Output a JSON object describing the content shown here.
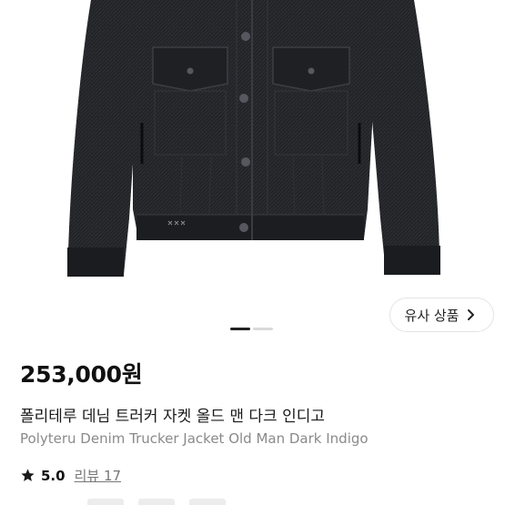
{
  "product": {
    "image_icon": "denim-jacket-photo",
    "price": "253,000원",
    "title_ko": "폴리테루 데님 트러커 자켓 올드 맨 다크 인디고",
    "title_en": "Polyteru Denim Trucker Jacket Old Man Dark Indigo",
    "rating": "5.0",
    "review_label": "리뷰 17"
  },
  "carousel": {
    "active_index": 0,
    "count": 2
  },
  "similar_button": {
    "label": "유사 상품",
    "icon": "chevron-right-icon"
  },
  "colors": {
    "jacket": "#1e1f22",
    "star": "#1a1a1a",
    "muted_text": "#8a8a8a"
  }
}
